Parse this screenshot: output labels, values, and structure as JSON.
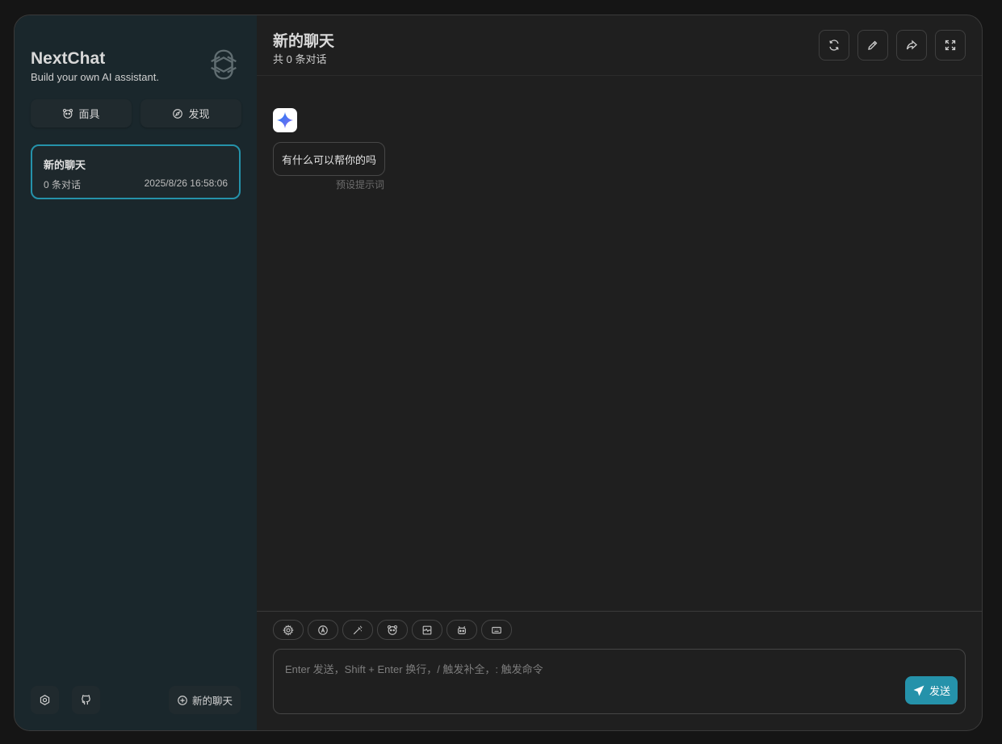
{
  "sidebar": {
    "brand_title": "NextChat",
    "brand_subtitle": "Build your own AI assistant.",
    "mask_label": "面具",
    "discover_label": "发现",
    "chat_list": [
      {
        "title": "新的聊天",
        "count": "0 条对话",
        "time": "2025/8/26 16:58:06"
      }
    ],
    "new_chat_label": "新的聊天"
  },
  "header": {
    "title": "新的聊天",
    "subtitle": "共 0 条对话"
  },
  "messages": [
    {
      "text": "有什么可以帮你的吗",
      "note": "预设提示词"
    }
  ],
  "input": {
    "placeholder": "Enter 发送，Shift + Enter 换行，/ 触发补全，: 触发命令",
    "send_label": "发送"
  },
  "colors": {
    "accent": "#2592aa",
    "sidebar_bg": "#1a272c",
    "main_bg": "#1f1f1f"
  }
}
